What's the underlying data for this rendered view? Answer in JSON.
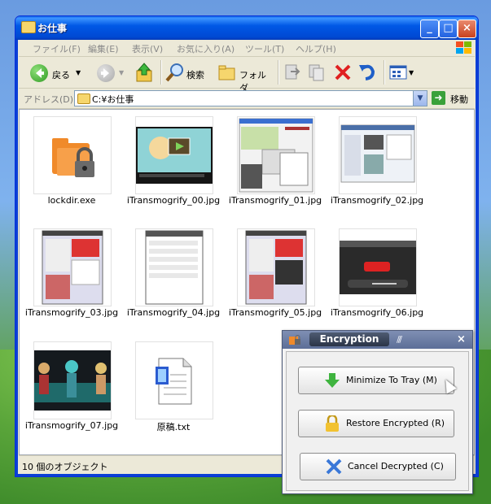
{
  "window": {
    "title": "お仕事",
    "controls": {
      "minimize": "_",
      "maximize": "□",
      "close": "×"
    }
  },
  "menu": [
    {
      "label": "ファイル(F)"
    },
    {
      "label": "編集(E)"
    },
    {
      "label": "表示(V)"
    },
    {
      "label": "お気に入り(A)"
    },
    {
      "label": "ツール(T)"
    },
    {
      "label": "ヘルプ(H)"
    }
  ],
  "toolbar": {
    "back_label": "戻る",
    "search_label": "検索",
    "folders_label": "フォルダ"
  },
  "address": {
    "label": "アドレス(D)",
    "value": "C:¥お仕事",
    "go_label": "移動"
  },
  "files": [
    {
      "name": "lockdir.exe",
      "icon": "lock-folder-icon"
    },
    {
      "name": "iTransmogrify_00.jpg",
      "icon": "video-thumbnail"
    },
    {
      "name": "iTransmogrify_01.jpg",
      "icon": "screenshot-thumbnail"
    },
    {
      "name": "iTransmogrify_02.jpg",
      "icon": "screenshot-thumbnail"
    },
    {
      "name": "iTransmogrify_03.jpg",
      "icon": "screenshot-thumbnail"
    },
    {
      "name": "iTransmogrify_04.jpg",
      "icon": "screenshot-thumbnail"
    },
    {
      "name": "iTransmogrify_05.jpg",
      "icon": "screenshot-thumbnail"
    },
    {
      "name": "iTransmogrify_06.jpg",
      "icon": "youtube-thumbnail"
    },
    {
      "name": "iTransmogrify_07.jpg",
      "icon": "video-thumbnail"
    },
    {
      "name": "原稿.txt",
      "icon": "text-file-icon"
    }
  ],
  "status": {
    "text": "10 個のオブジェクト"
  },
  "popup": {
    "title": "Encryption",
    "grip": "///",
    "close": "×",
    "buttons": [
      {
        "label": "Minimize To Tray (M)",
        "icon": "down-arrow-icon"
      },
      {
        "label": "Restore Encrypted (R)",
        "icon": "padlock-icon"
      },
      {
        "label": "Cancel Decrypted (C)",
        "icon": "x-cross-icon"
      }
    ]
  },
  "colors": {
    "titlebar": "#0058e6",
    "popup_title": "#5c6e97",
    "desktop_sky": "#7fb2ee",
    "desktop_grass": "#5aa53a"
  }
}
